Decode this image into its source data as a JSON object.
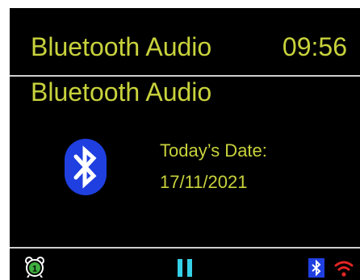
{
  "header": {
    "title": "Bluetooth Audio",
    "clock": "09:56"
  },
  "main": {
    "source_title": "Bluetooth Audio",
    "date_label": "Today’s Date:",
    "date_value": "17/11/2021"
  },
  "status_bar": {
    "alarm_number": "1",
    "icons": [
      "alarm-clock-icon",
      "pause-icon",
      "bluetooth-icon",
      "wifi-icon"
    ]
  },
  "colors": {
    "background": "#000000",
    "text": "#c8d23c",
    "bluetooth": "#1f3fe0",
    "pause": "#35d0e6",
    "wifi": "#e32424",
    "alarm_badge": "#3fae3f"
  }
}
